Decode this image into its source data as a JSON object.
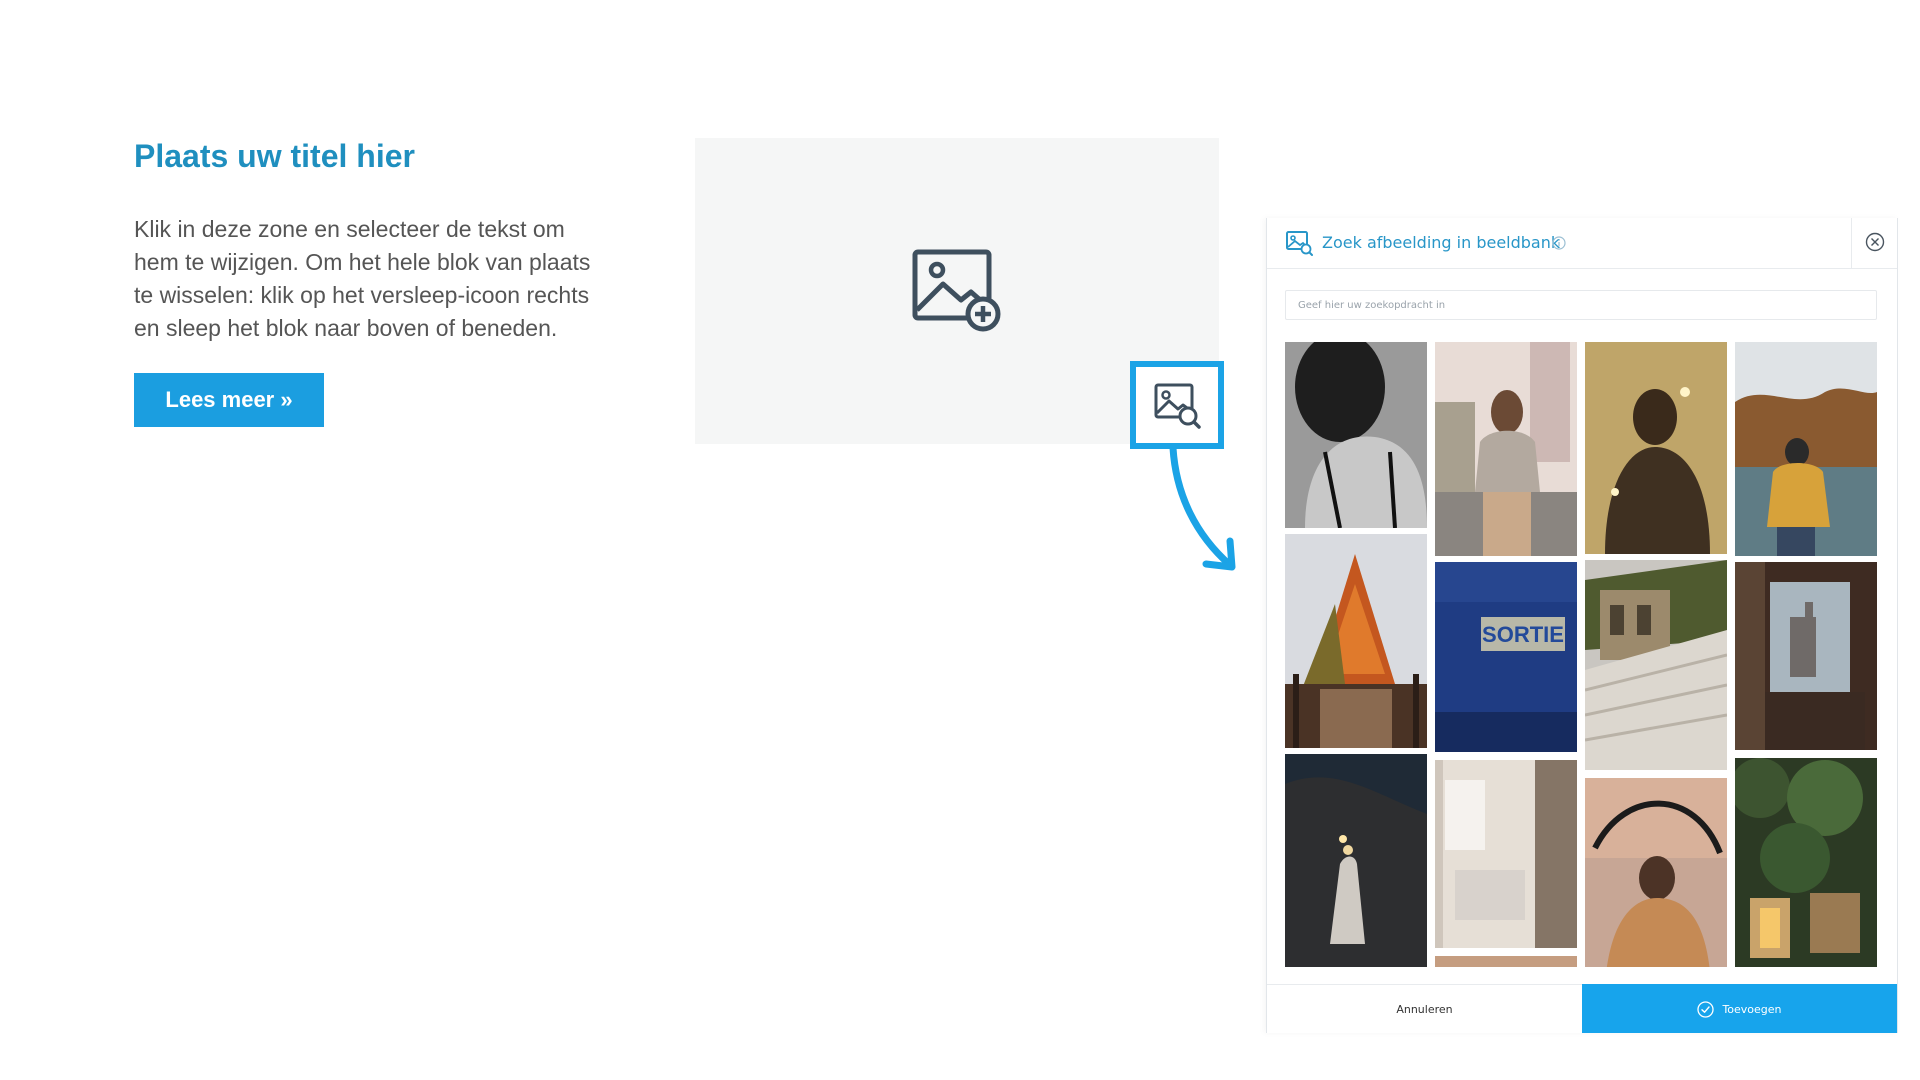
{
  "content_block": {
    "title": "Plaats uw titel hier",
    "body_lines": [
      "Klik in deze zone en selecteer de tekst om",
      "hem te wijzigen. Om het hele blok van plaats",
      "te wisselen: klik op het versleep-icoon rechts",
      "en sleep het blok naar boven of beneden."
    ],
    "button_label": "Lees meer »"
  },
  "icons": {
    "add_image": "image-add-icon",
    "image_bank": "image-search-icon"
  },
  "dialog": {
    "title": "Zoek afbeelding in beeldbank",
    "search_placeholder": "Geef hier uw zoekopdracht in",
    "cancel_label": "Annuleren",
    "add_label": "Toevoegen",
    "photos": [
      {
        "description": "black and white woman back view"
      },
      {
        "description": "woman standing in city street"
      },
      {
        "description": "silhouette in golden light"
      },
      {
        "description": "man by autumn lake"
      },
      {
        "description": "autumn tree and wooden bridge"
      },
      {
        "description": "blue door with sign",
        "sign_text": "SORTIE"
      },
      {
        "description": "ancient amphitheater ruins"
      },
      {
        "description": "window with city view"
      },
      {
        "description": "woman in white dress at night"
      },
      {
        "description": "bright bedroom interior"
      },
      {
        "description": "woman in sweater at sunset"
      },
      {
        "description": "ivy covered building"
      }
    ]
  },
  "colors": {
    "title_blue": "#1f8fbf",
    "button_blue": "#1b9ee0",
    "accent_blue": "#17a4ec",
    "placeholder_gray": "#f5f6f6"
  }
}
